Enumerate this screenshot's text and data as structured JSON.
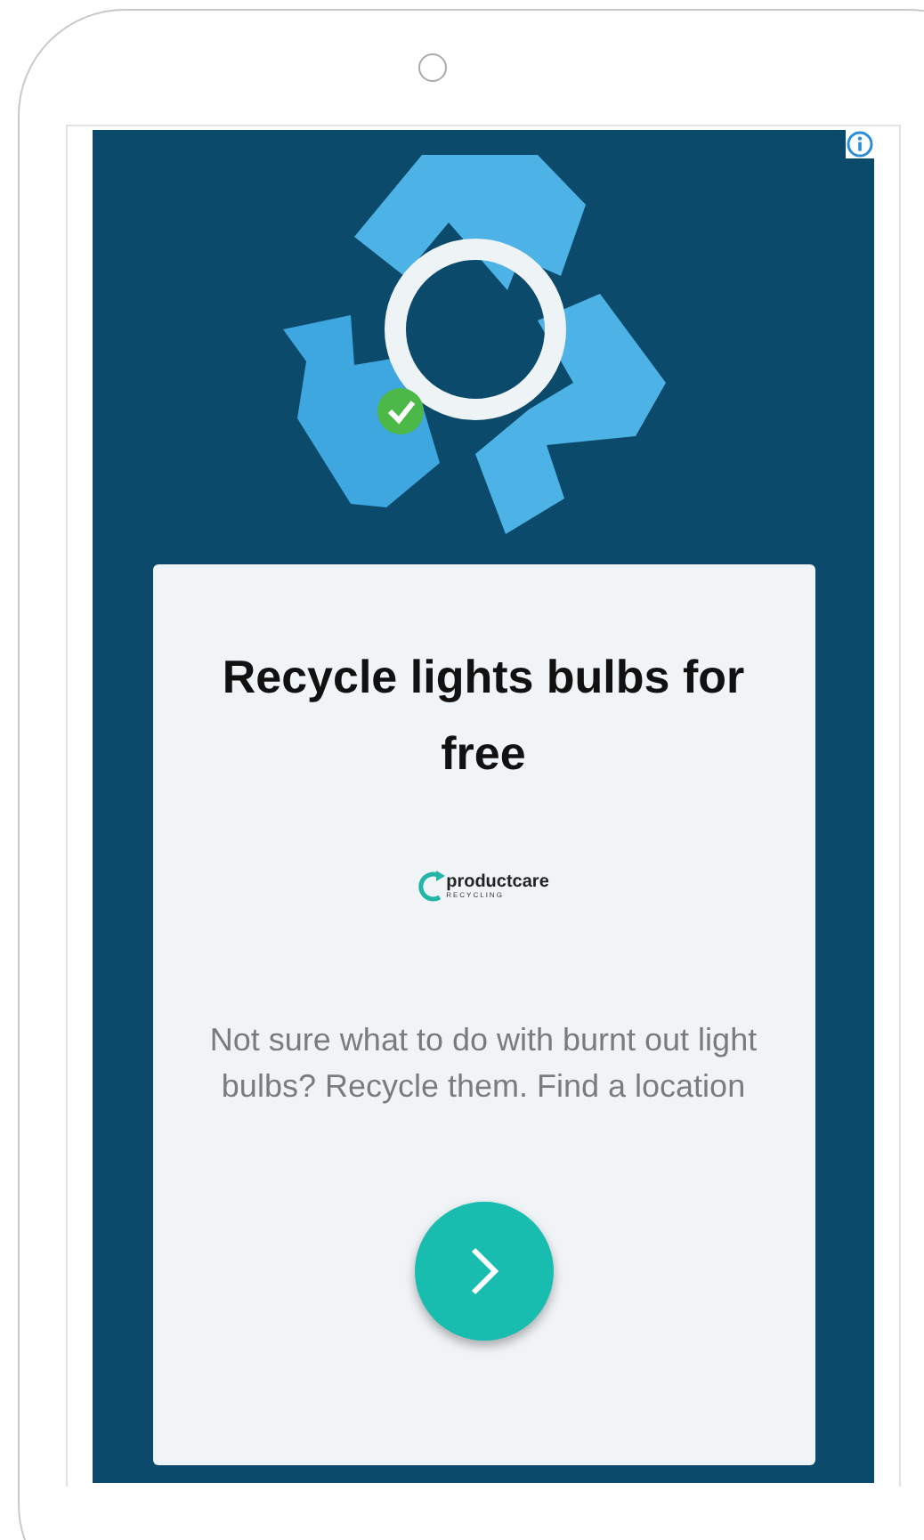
{
  "ad": {
    "headline": "Recycle lights bulbs for free",
    "logo": {
      "name": "productcare",
      "tagline": "RECYCLING"
    },
    "description": "Not sure what to do with burnt out light bulbs? Recycle them. Find a location"
  }
}
